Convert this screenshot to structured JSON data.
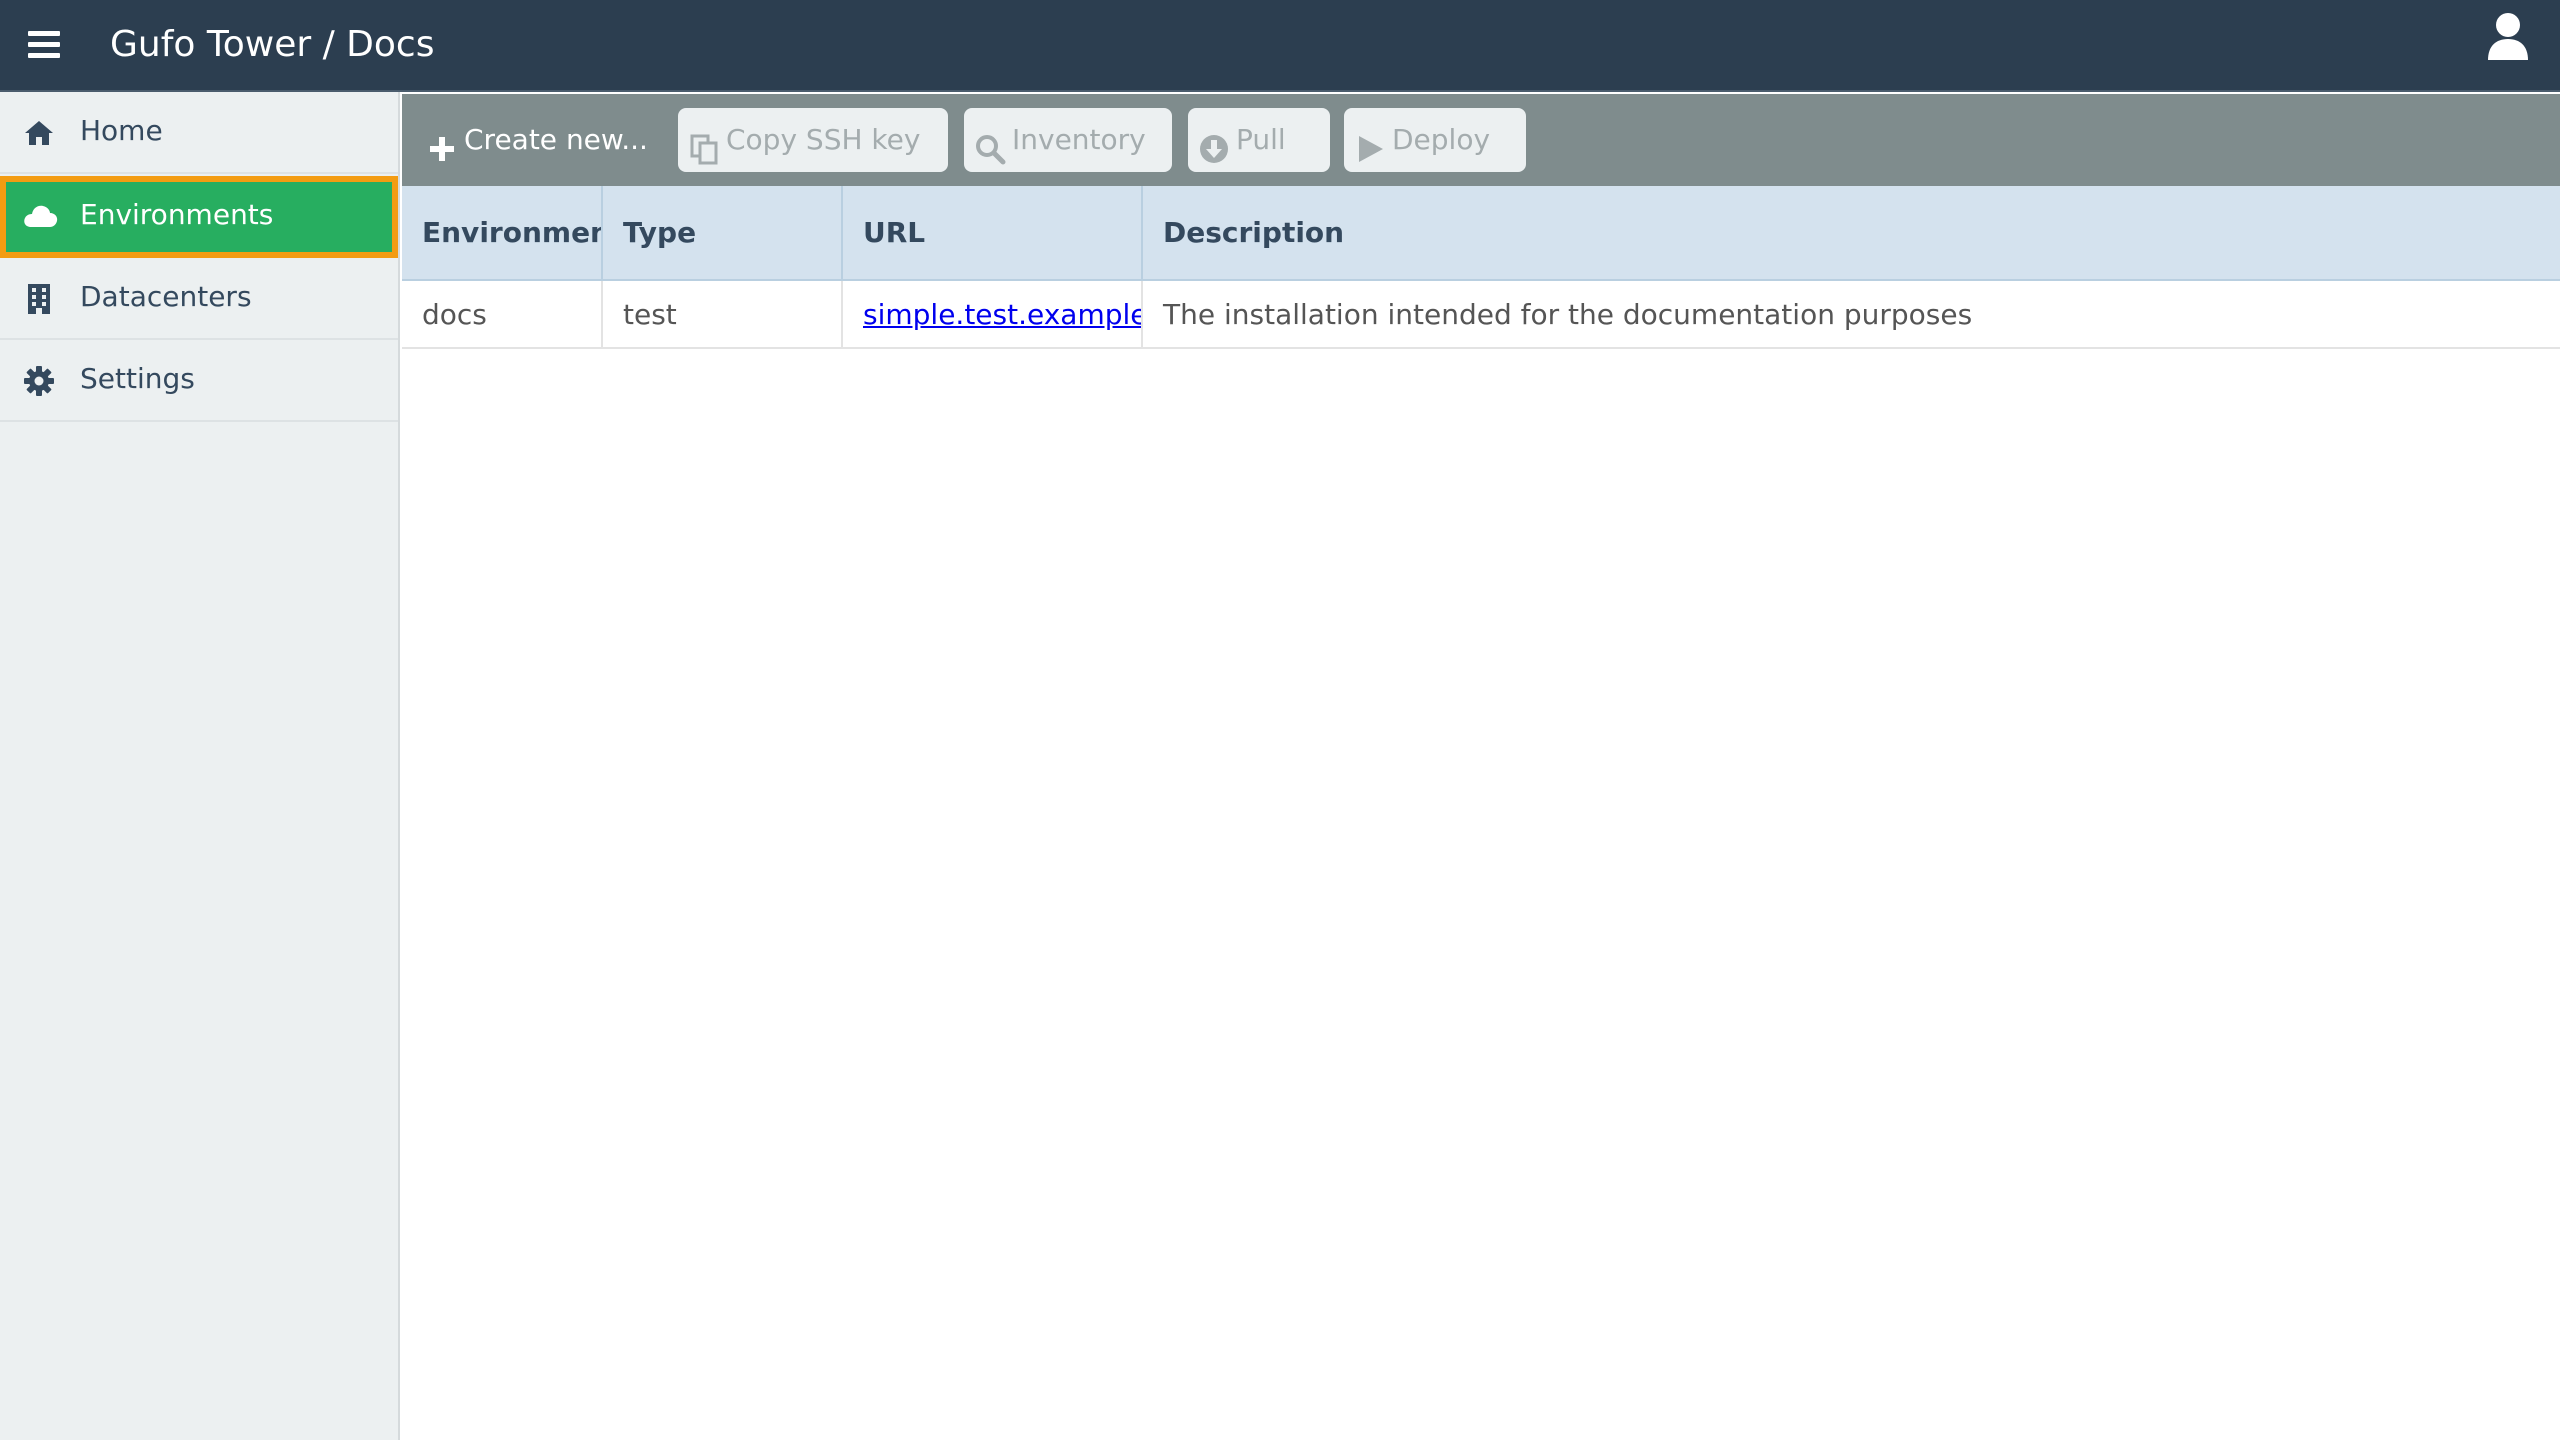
{
  "header": {
    "title": "Gufo Tower / Docs",
    "menu_icon": "hamburger-icon",
    "user_icon": "user-icon",
    "background": "#2c3e50"
  },
  "sidebar": {
    "items": [
      {
        "label": "Home",
        "icon": "home-icon"
      },
      {
        "label": "Environments",
        "icon": "cloud-icon",
        "active": true
      },
      {
        "label": "Datacenters",
        "icon": "building-icon"
      },
      {
        "label": "Settings",
        "icon": "gear-icon"
      }
    ],
    "active_color": "#27ae60",
    "active_border_color": "#f39c12"
  },
  "toolbar": {
    "create": {
      "label": "Create new...",
      "icon": "plus-icon",
      "enabled": true
    },
    "copy_ssh": {
      "label": "Copy SSH key",
      "icon": "copy-icon",
      "enabled": false
    },
    "inventory": {
      "label": "Inventory",
      "icon": "search-icon",
      "enabled": false
    },
    "pull": {
      "label": "Pull",
      "icon": "download-circle-icon",
      "enabled": false
    },
    "deploy": {
      "label": "Deploy",
      "icon": "play-icon",
      "enabled": false
    }
  },
  "table": {
    "columns": [
      "Environment",
      "Type",
      "URL",
      "Description"
    ],
    "rows": [
      {
        "environment": "docs",
        "type": "test",
        "url": "simple.test.example.com",
        "description": "The installation intended for the documentation purposes"
      }
    ]
  }
}
